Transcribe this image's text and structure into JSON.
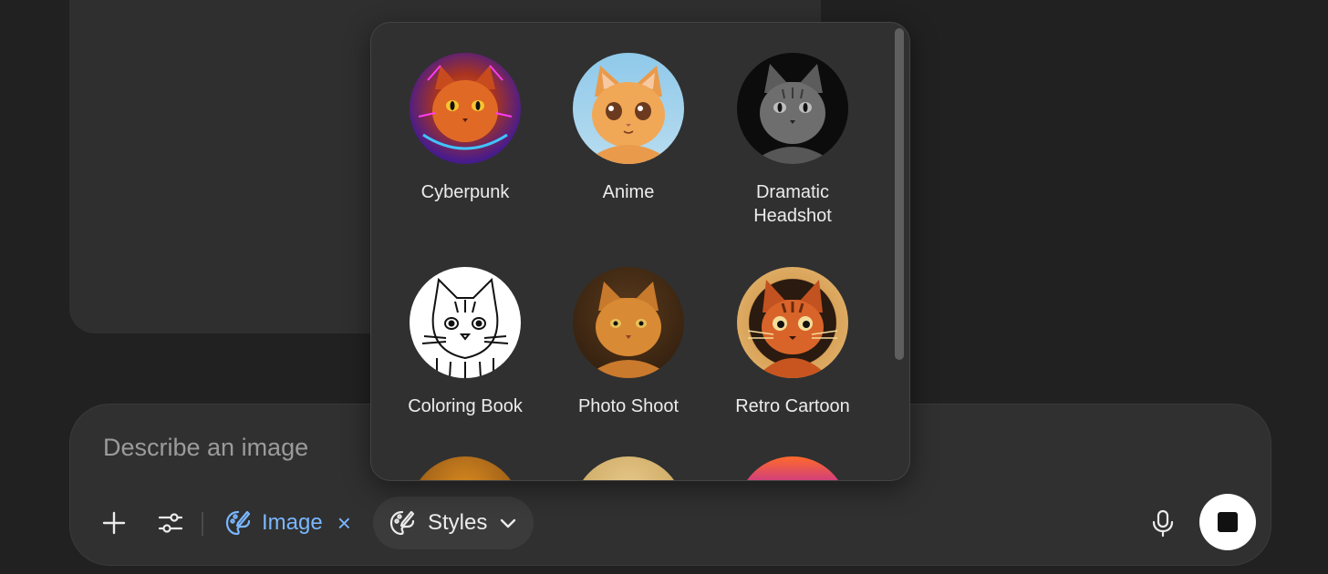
{
  "composer": {
    "placeholder": "Describe an image",
    "image_chip_label": "Image",
    "image_chip_close": "×",
    "styles_label": "Styles"
  },
  "styles_menu": {
    "items": [
      {
        "label": "Cyberpunk"
      },
      {
        "label": "Anime"
      },
      {
        "label": "Dramatic Headshot"
      },
      {
        "label": "Coloring Book"
      },
      {
        "label": "Photo Shoot"
      },
      {
        "label": "Retro Cartoon"
      }
    ]
  },
  "colors": {
    "background": "#212121",
    "panel": "#303030",
    "accent": "#7ab7ff"
  }
}
